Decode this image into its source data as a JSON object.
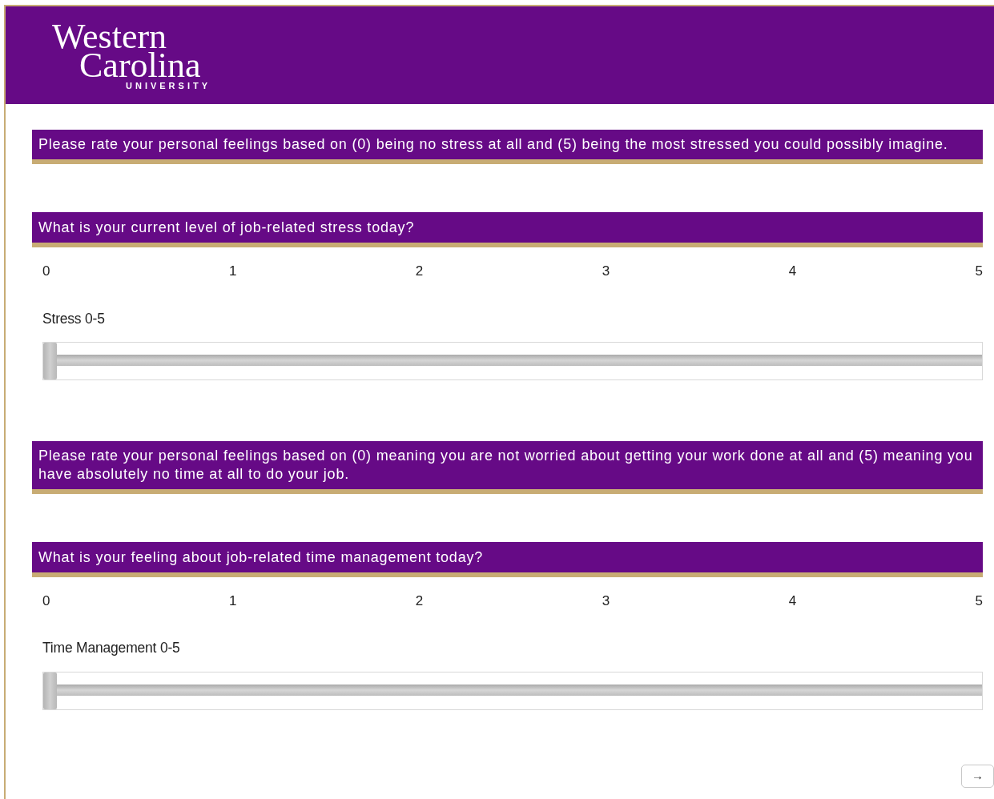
{
  "header": {
    "logo": {
      "line_1": "Western",
      "line_2": "Carolina",
      "line_3": "UNIVERSITY"
    }
  },
  "blocks": [
    {
      "kind": "instruction",
      "text": "Please rate your personal feelings based on (0) being no stress at all and (5) being the most stressed you could possibly imagine."
    },
    {
      "kind": "slider",
      "question": "What is your current level of job-related stress today?",
      "ticks": [
        "0",
        "1",
        "2",
        "3",
        "4",
        "5"
      ],
      "label": "Stress 0-5",
      "level": 0
    },
    {
      "kind": "instruction",
      "text": "Please rate your personal feelings based on (0) meaning you are not worried about getting your work done at all and (5) meaning you have absolutely no time at all to do your job."
    },
    {
      "kind": "slider",
      "question": "What is your feeling about job-related time management today?",
      "ticks": [
        "0",
        "1",
        "2",
        "3",
        "4",
        "5"
      ],
      "label": "Time Management 0-5",
      "level": 0
    }
  ],
  "next_button": {
    "label": "→"
  }
}
